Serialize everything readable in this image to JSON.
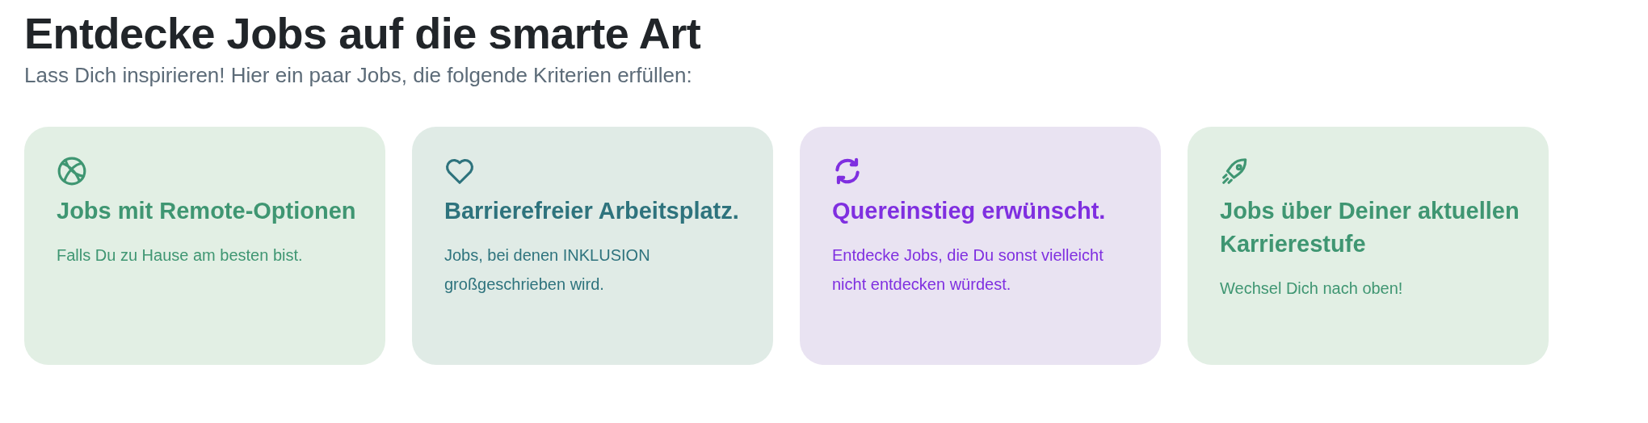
{
  "heading": "Entdecke Jobs auf die smarte Art",
  "subheading": "Lass Dich inspirieren! Hier ein paar Jobs, die folgende Kriterien erfüllen:",
  "cards": [
    {
      "kind": "globe",
      "color": "#3f9672",
      "title": "Jobs mit Remote-Optionen",
      "text": "Falls Du zu Hause am besten bist."
    },
    {
      "kind": "heart",
      "color": "#2e737d",
      "title": "Barrierefreier Arbeitsplatz.",
      "text": "Jobs, bei denen INKLUSION großgeschrieben wird."
    },
    {
      "kind": "refresh",
      "color": "#7f2fe0",
      "title": "Quereinstieg erwünscht.",
      "text": "Entdecke Jobs, die Du sonst vielleicht nicht entdecken würdest."
    },
    {
      "kind": "rocket",
      "color": "#3f9672",
      "title": "Jobs über Deiner aktuellen Karrierestufe",
      "text": "Wechsel Dich nach oben!"
    }
  ]
}
